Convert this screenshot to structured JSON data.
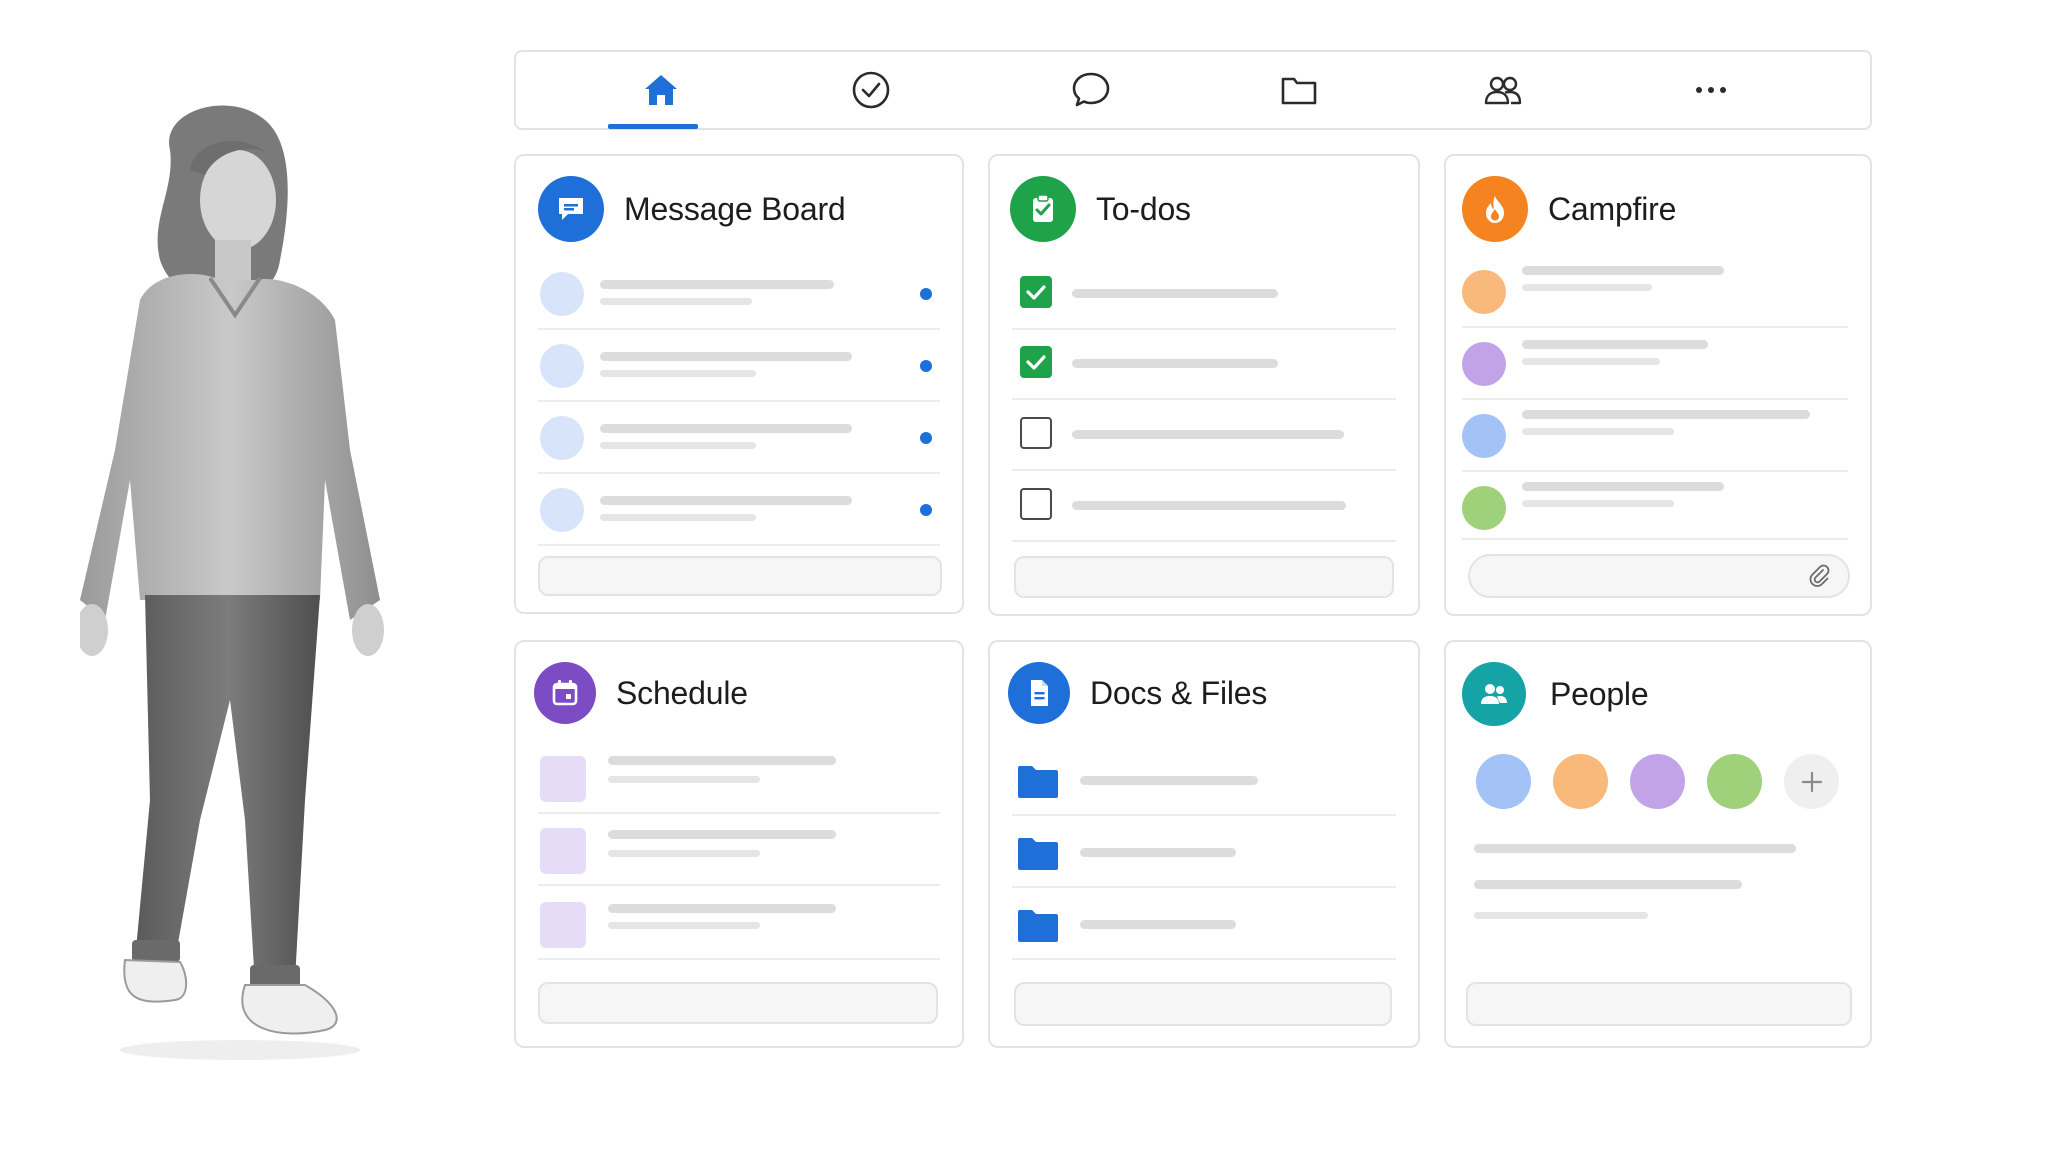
{
  "colors": {
    "accent_blue": "#1f6fd9",
    "todo_green": "#1fa34a",
    "campfire_orange": "#f5831f",
    "schedule_purple": "#7b4cc4",
    "people_teal": "#16a3a6"
  },
  "nav": {
    "items": [
      {
        "icon": "home-icon",
        "active": true
      },
      {
        "icon": "check-circle-icon",
        "active": false
      },
      {
        "icon": "chat-bubble-icon",
        "active": false
      },
      {
        "icon": "folder-icon",
        "active": false
      },
      {
        "icon": "people-icon",
        "active": false
      },
      {
        "icon": "more-icon",
        "active": false
      }
    ]
  },
  "cards": {
    "message_board": {
      "title": "Message Board",
      "icon": "message-icon",
      "unread_count": 4
    },
    "todos": {
      "title": "To-dos",
      "icon": "clipboard-check-icon",
      "items_checked": [
        true,
        true,
        false,
        false
      ]
    },
    "campfire": {
      "title": "Campfire",
      "icon": "flame-icon",
      "avatar_colors": [
        "#f9b97a",
        "#c3a3e8",
        "#a3c2f5",
        "#9fd07a"
      ],
      "attachment_icon": "paperclip-icon"
    },
    "schedule": {
      "title": "Schedule",
      "icon": "calendar-icon"
    },
    "docs_files": {
      "title": "Docs & Files",
      "icon": "document-icon",
      "folder_icon": "folder-icon"
    },
    "people": {
      "title": "People",
      "icon": "people-icon",
      "avatar_colors": [
        "#a3c2f5",
        "#f9b97a",
        "#c3a3e8",
        "#9fd07a"
      ],
      "add_icon": "plus-icon"
    }
  }
}
